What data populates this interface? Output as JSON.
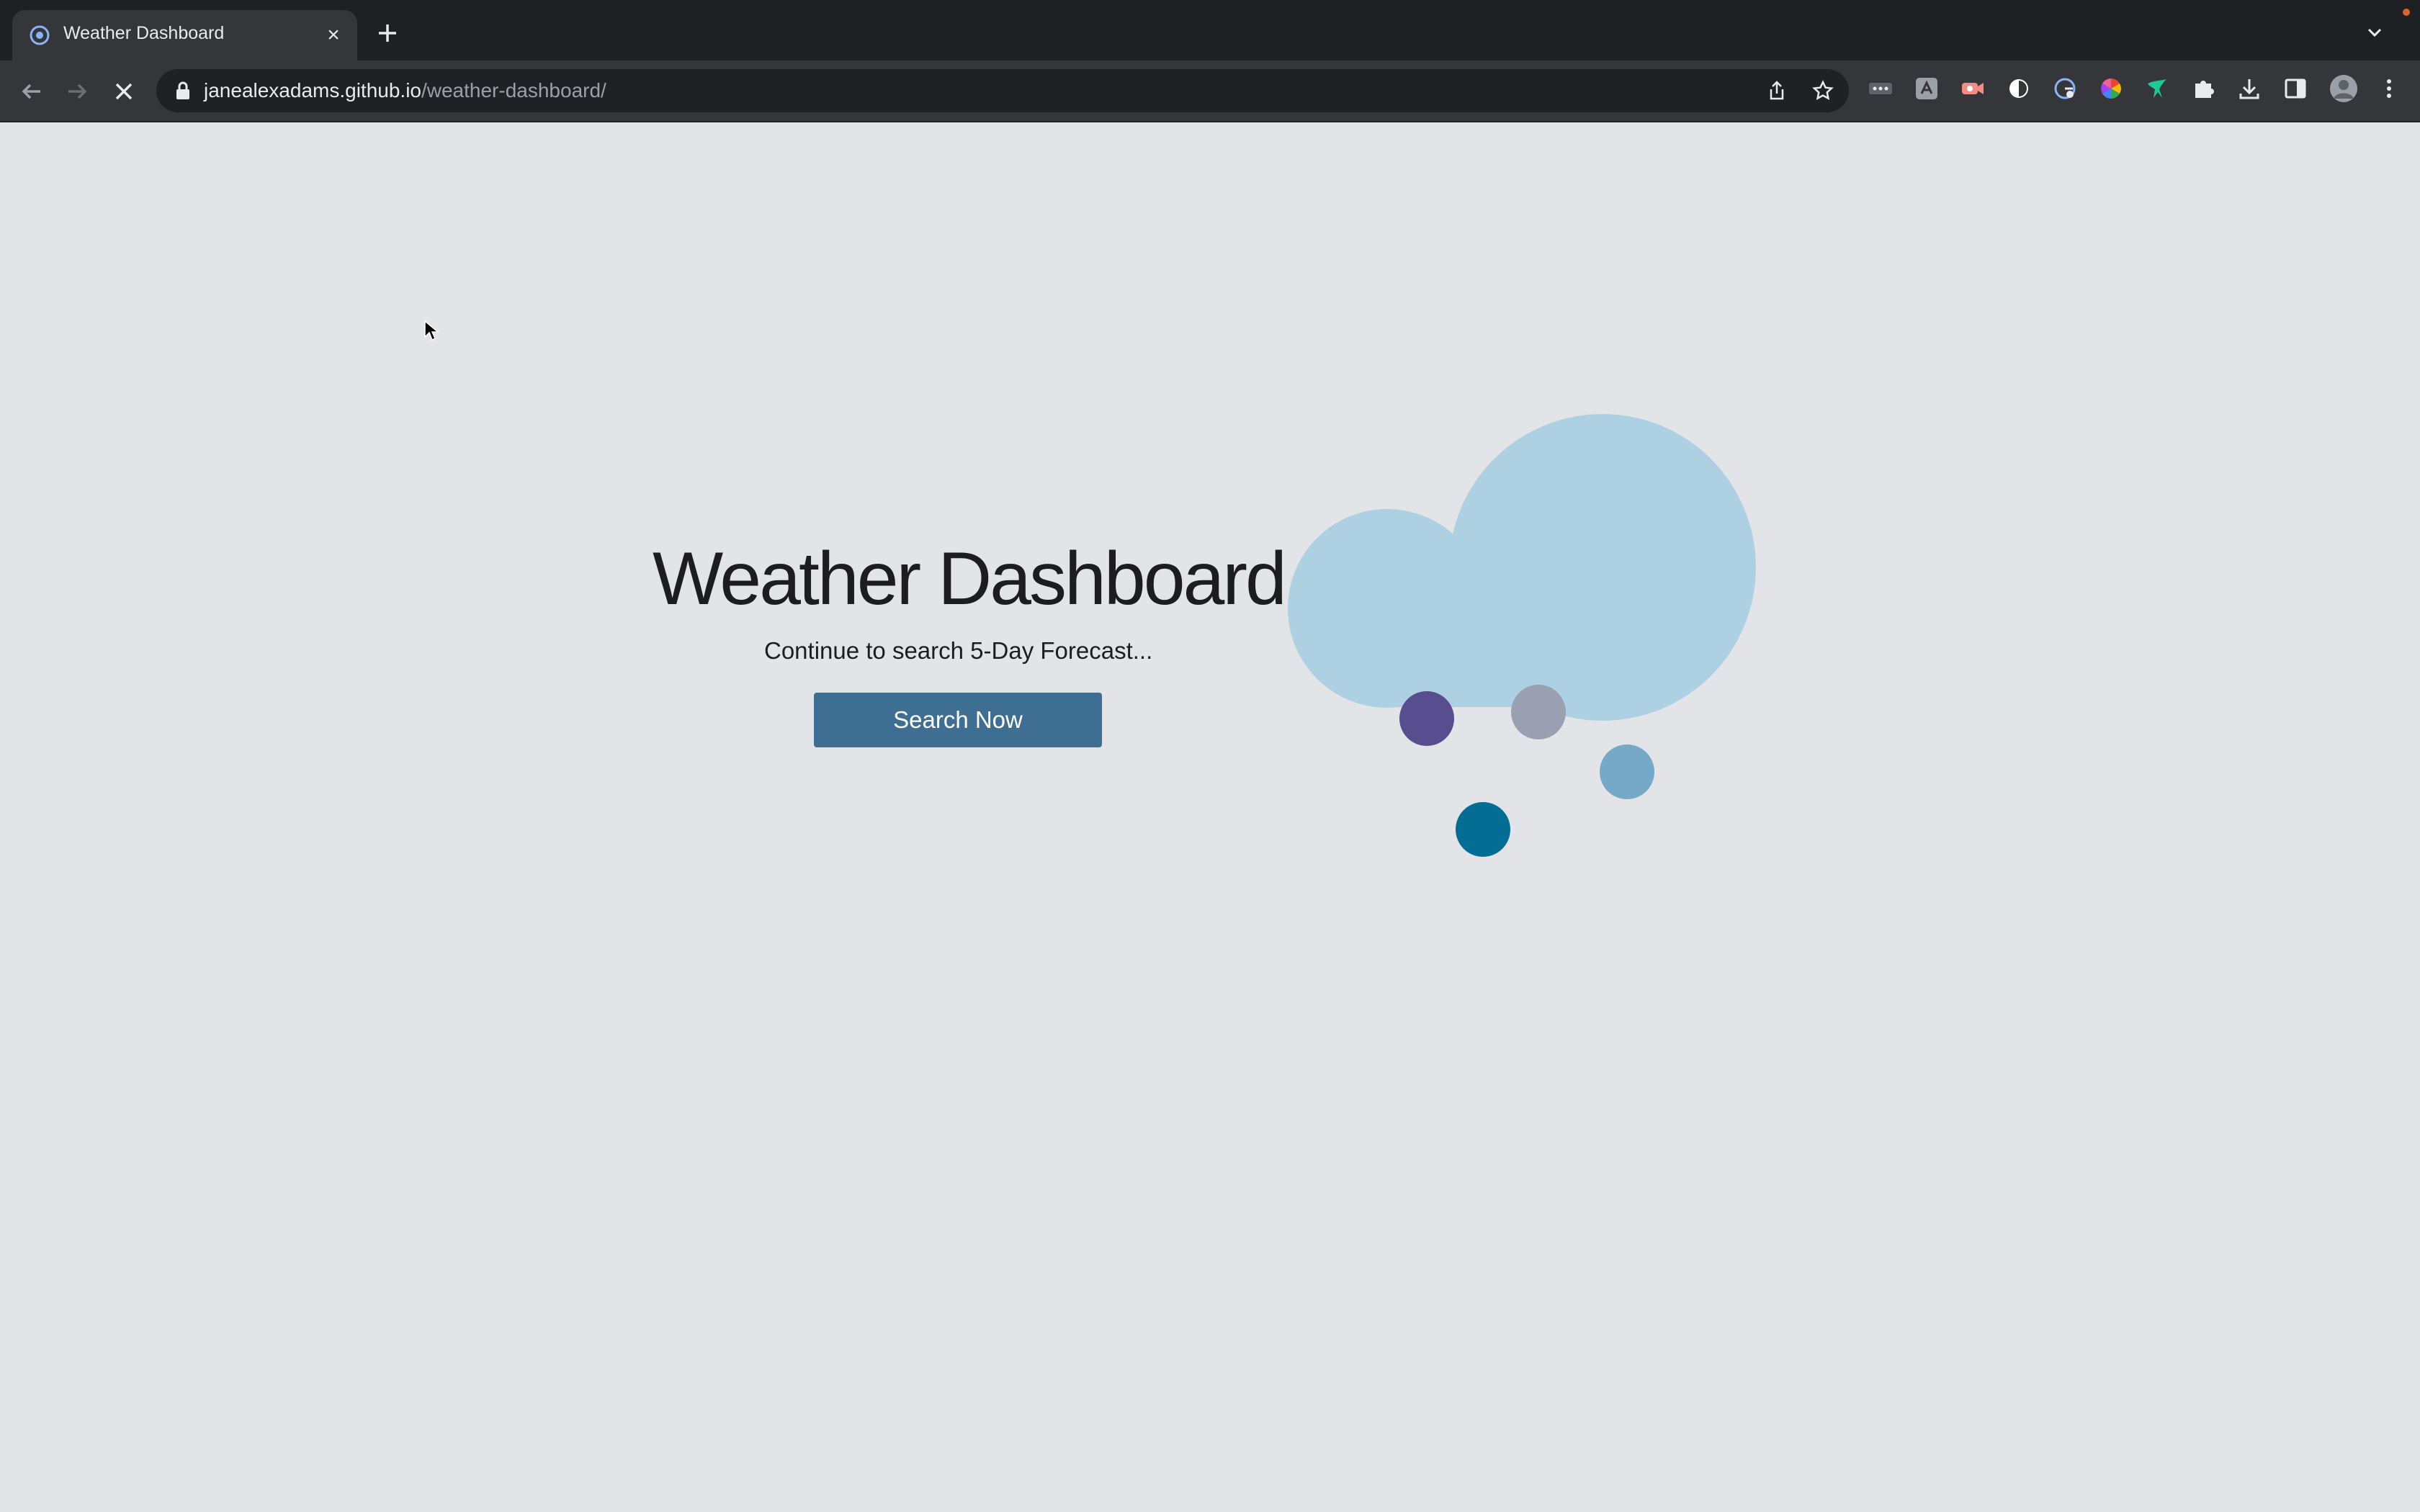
{
  "browser": {
    "tab": {
      "title": "Weather Dashboard",
      "favicon": "chrome-favicon-icon"
    },
    "address_bar": {
      "host": "janealexadams.github.io",
      "path": "/weather-dashboard/"
    },
    "colors": {
      "tabstrip": "#1f2023",
      "toolbar": "#35363a",
      "omnibox": "#202124"
    },
    "extensions": [
      "more-dots-icon",
      "translate-icon",
      "record-icon",
      "circle-half-icon",
      "globe-g-icon",
      "color-wheel-icon",
      "bird-icon",
      "puzzle-icon",
      "download-icon",
      "side-panel-icon",
      "profile-avatar",
      "menu-dots-icon"
    ]
  },
  "page": {
    "title": "Weather Dashboard",
    "subtitle": "Continue to search 5-Day Forecast...",
    "button_label": "Search Now",
    "colors": {
      "background": "#e3e4e7",
      "button": "#3f6e93",
      "cloud": "#aed0e3",
      "drop_purple": "#574d8f",
      "drop_gray": "#9b9fb2",
      "drop_light_blue": "#76a8c7",
      "drop_teal": "#046d94"
    }
  }
}
